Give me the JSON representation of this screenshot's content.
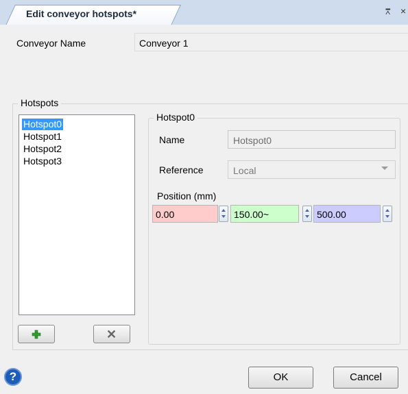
{
  "tab": {
    "title": "Edit conveyor hotspots*",
    "pin_glyph": "⊮",
    "close_glyph": "×"
  },
  "conveyor": {
    "label": "Conveyor Name",
    "value": "Conveyor 1"
  },
  "hotspots": {
    "group_label": "Hotspots",
    "items": [
      "Hotspot0",
      "Hotspot1",
      "Hotspot2",
      "Hotspot3"
    ],
    "selected_index": 0,
    "add_icon": "plus-icon",
    "remove_icon": "x-icon"
  },
  "detail": {
    "group_label": "Hotspot0",
    "name_label": "Name",
    "name_value": "Hotspot0",
    "reference_label": "Reference",
    "reference_value": "Local",
    "position_label": "Position (mm)",
    "position": {
      "x": {
        "value": "0.00",
        "color": "#ffcccc"
      },
      "y": {
        "value": "150.00~",
        "color": "#ccffcc"
      },
      "z": {
        "value": "500.00",
        "color": "#ccccff"
      }
    }
  },
  "footer": {
    "ok_label": "OK",
    "cancel_label": "Cancel",
    "help_icon": "help-icon"
  },
  "colors": {
    "selection": "#3399ff",
    "help": "#1c5db8",
    "accent": "#d5e2f2"
  }
}
